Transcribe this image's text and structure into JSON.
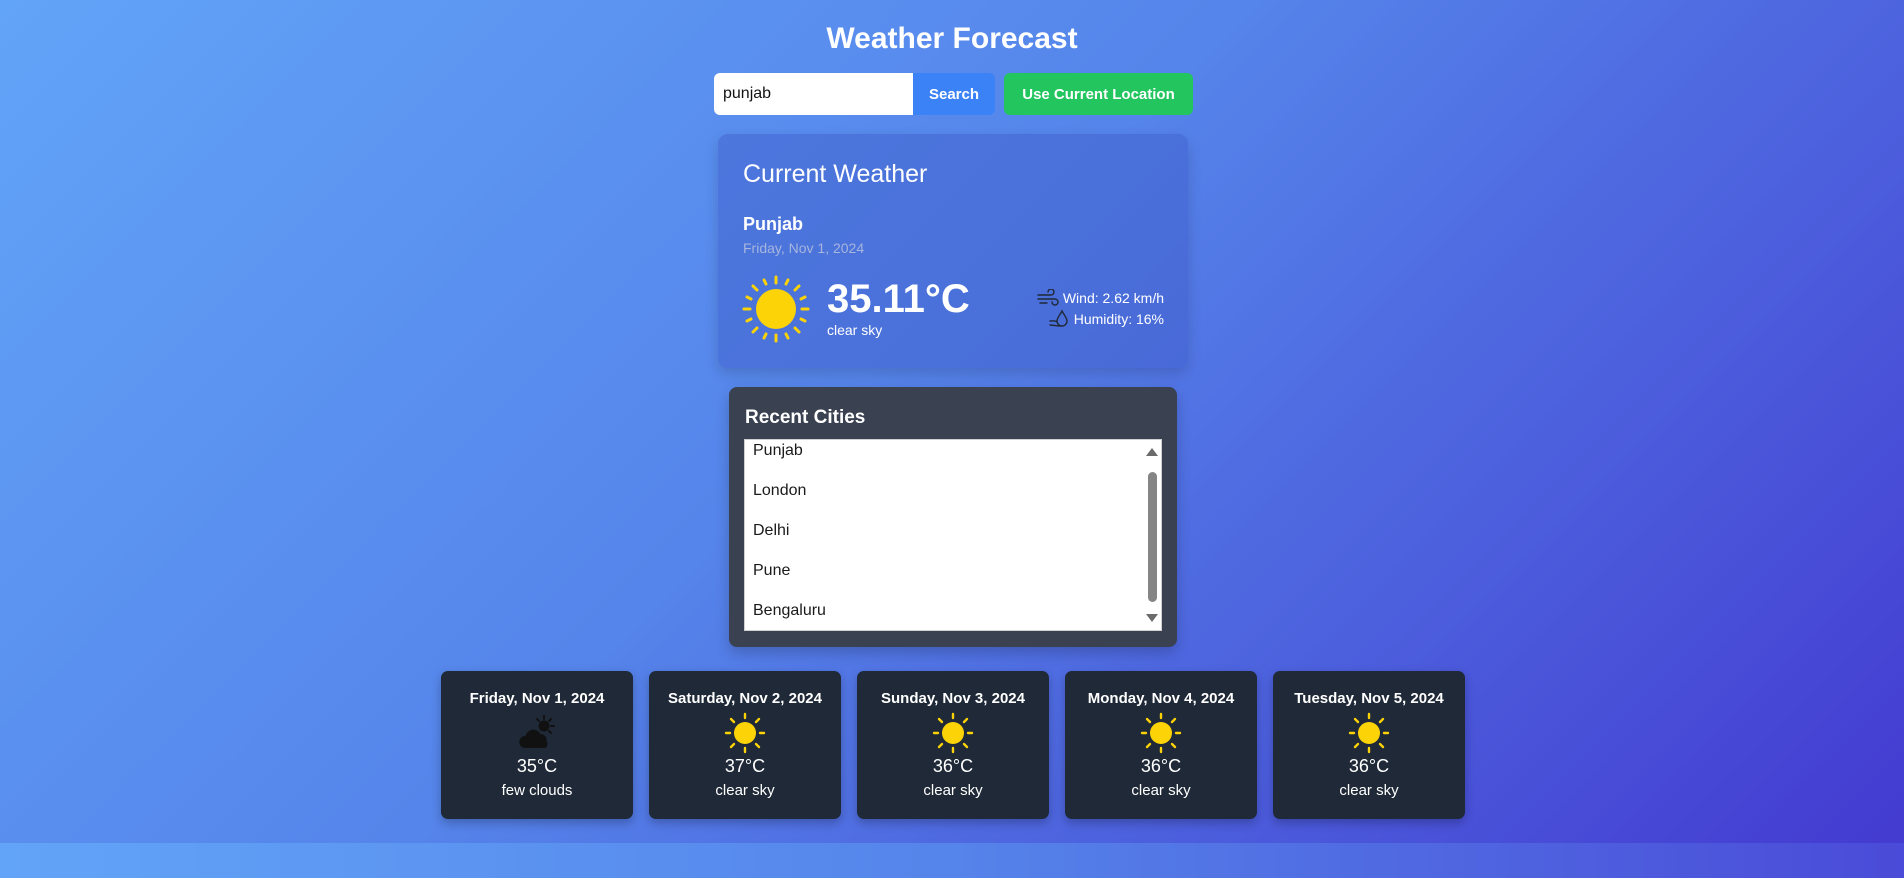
{
  "header": {
    "title": "Weather Forecast"
  },
  "search": {
    "value": "punjab",
    "search_label": "Search",
    "location_label": "Use Current Location"
  },
  "current": {
    "heading": "Current Weather",
    "city": "Punjab",
    "date": "Friday, Nov 1, 2024",
    "temp": "35.11°C",
    "description": "clear sky",
    "wind": "Wind: 2.62 km/h",
    "humidity": "Humidity: 16%",
    "icon": "sun-icon"
  },
  "recent": {
    "title": "Recent Cities",
    "items": [
      "Punjab",
      "London",
      "Delhi",
      "Pune",
      "Bengaluru"
    ]
  },
  "forecast": [
    {
      "date": "Friday, Nov 1, 2024",
      "temp": "35°C",
      "description": "few clouds",
      "icon": "cloud-sun-icon"
    },
    {
      "date": "Saturday, Nov 2, 2024",
      "temp": "37°C",
      "description": "clear sky",
      "icon": "sun-icon"
    },
    {
      "date": "Sunday, Nov 3, 2024",
      "temp": "36°C",
      "description": "clear sky",
      "icon": "sun-icon"
    },
    {
      "date": "Monday, Nov 4, 2024",
      "temp": "36°C",
      "description": "clear sky",
      "icon": "sun-icon"
    },
    {
      "date": "Tuesday, Nov 5, 2024",
      "temp": "36°C",
      "description": "clear sky",
      "icon": "sun-icon"
    }
  ],
  "colors": {
    "search_button": "#3b82f6",
    "location_button": "#22c55e",
    "sun": "#fcd307",
    "card_dark": "#1f2937",
    "recent_card": "#3a4150"
  }
}
